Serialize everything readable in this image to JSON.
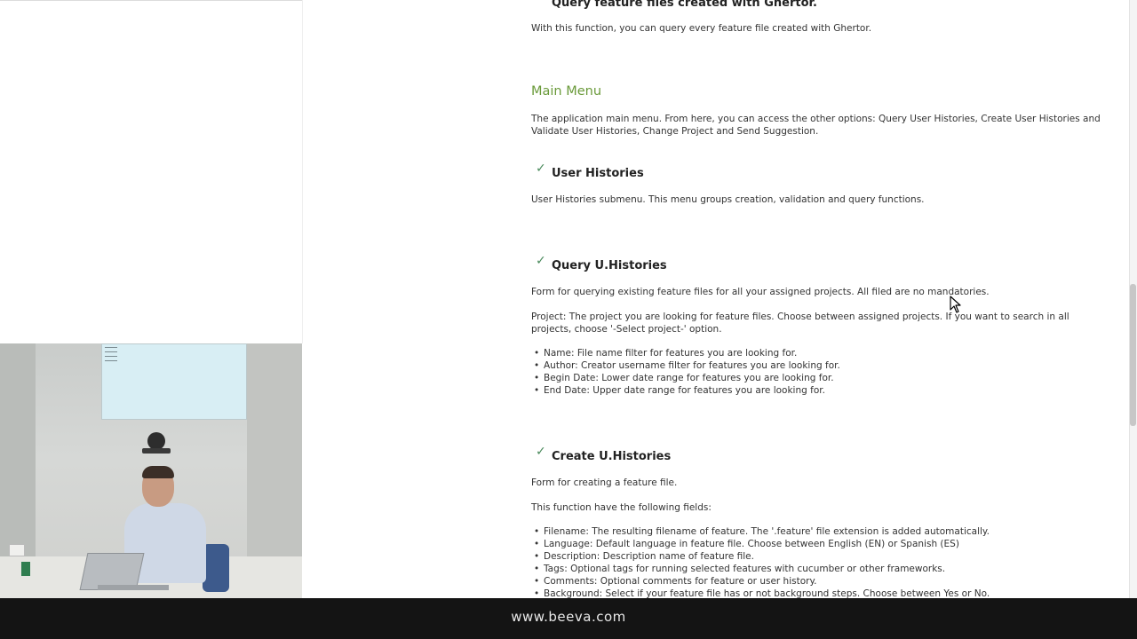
{
  "doc": {
    "query_features": {
      "title": "Query feature files created with Ghertor.",
      "desc": "With this function, you can query every feature file created with Ghertor."
    },
    "main_menu": {
      "title": "Main Menu",
      "desc": "The application main menu. From here, you can access the other options: Query User Histories, Create User Histories and Validate User Histories, Change Project and Send Suggestion."
    },
    "user_histories": {
      "title": "User Histories",
      "desc": "User Histories submenu. This menu groups creation, validation and query functions."
    },
    "query_uhistories": {
      "title": "Query U.Histories",
      "desc": "Form for querying existing feature files for all your assigned projects. All filed are no mandatories.",
      "project_desc": "Project: The project you are looking for feature files. Choose between assigned projects. If you want to search in all projects, choose '-Select project-' option.",
      "fields": [
        "Name: File name filter for features you are looking for.",
        "Author: Creator username filter for features you are looking for.",
        "Begin Date: Lower date range for features you are looking for.",
        "End Date: Upper date range for features you are looking for."
      ]
    },
    "create_uhistories": {
      "title": "Create U.Histories",
      "desc": "Form for creating a feature file.",
      "fields_intro": "This function have the following fields:",
      "fields": [
        "Filename: The resulting filename of feature. The '.feature' file extension is added automatically.",
        "Language: Default language in feature file. Choose between English (EN) or Spanish (ES)",
        "Description: Description name of feature file.",
        "Tags: Optional tags for running selected features with cucumber or other frameworks.",
        "Comments: Optional comments for feature or user history.",
        "Background: Select if your feature file has or not background steps. Choose between Yes or No."
      ]
    },
    "check_glyph": "✓"
  },
  "footer": {
    "url": "www.beeva.com"
  },
  "icons": {
    "check": "check-icon",
    "cursor": "mouse-cursor-icon"
  },
  "colors": {
    "heading_green": "#6a9a3a",
    "check_green": "#4a8a5c",
    "footer_bg": "#141414"
  }
}
